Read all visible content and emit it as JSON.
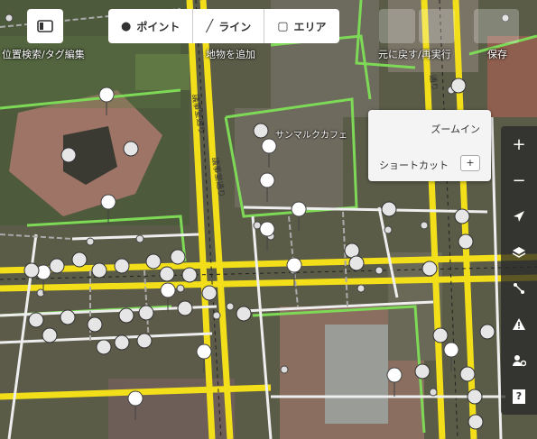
{
  "toolbar": {
    "sidebar_label": "位置検索/タグ編集",
    "point_label": "ポイント",
    "line_label": "ライン",
    "area_label": "エリア",
    "add_label": "地物を追加",
    "undo_label": "元に戻す/再実行",
    "save_label": "保存"
  },
  "map": {
    "poi_name": "サンマルクカフェ",
    "street_name": "議事堂通り",
    "street_name_2": "議事堂通り",
    "street_name_3": "通り"
  },
  "tooltip": {
    "zoom_in": "ズームイン",
    "shortcut": "ショートカット",
    "key": "+"
  },
  "right_controls": {
    "zoom_in": "+",
    "zoom_out": "−",
    "help": "?"
  }
}
